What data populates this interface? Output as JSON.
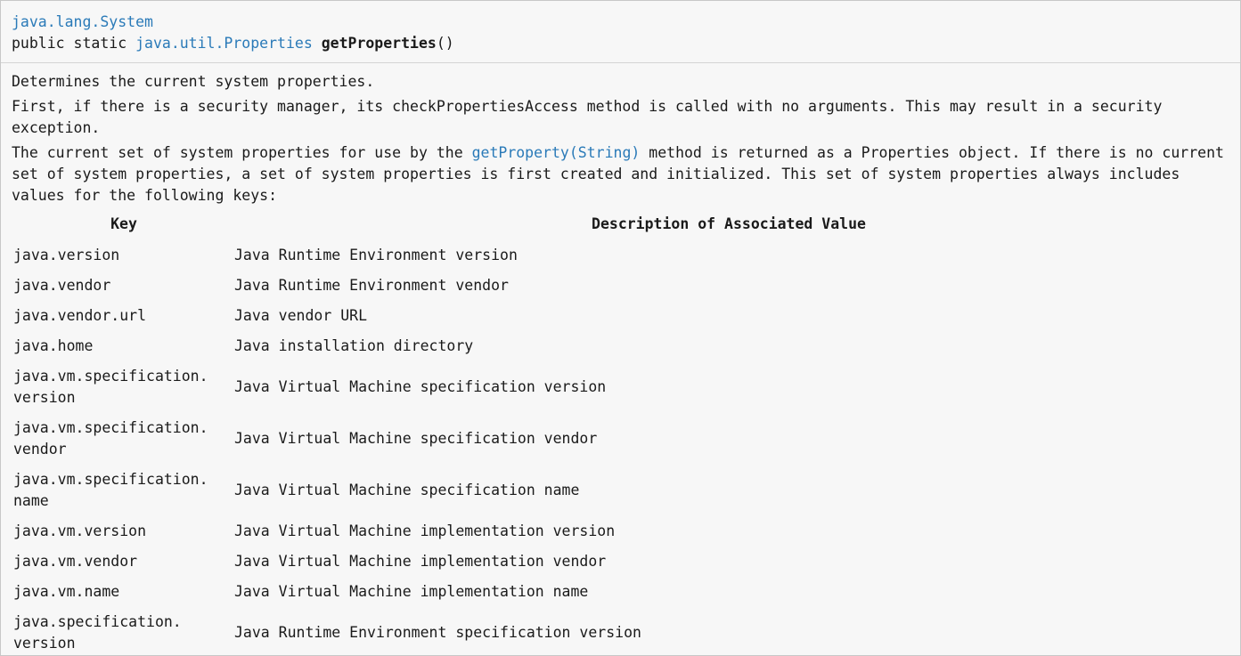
{
  "signature": {
    "class_name": "java.lang.System",
    "modifiers": "public static",
    "return_type": "java.util.Properties",
    "method_name": "getProperties",
    "params": "()"
  },
  "description": {
    "line1": "Determines the current system properties.",
    "para2": "First, if there is a security manager, its checkPropertiesAccess method is called with no arguments. This may result in a security exception.",
    "para3_before": "The current set of system properties for use by the",
    "para3_link": "getProperty(String)",
    "para3_after": "method is returned as a Properties object. If there is no current set of system properties, a set of system properties is first created and initialized. This set of system properties always includes values for the following keys:"
  },
  "table": {
    "headers": [
      "Key",
      "Description of Associated Value"
    ],
    "rows": [
      {
        "key": "java.version",
        "value": "Java Runtime Environment version"
      },
      {
        "key": "java.vendor",
        "value": "Java Runtime Environment vendor"
      },
      {
        "key": "java.vendor.url",
        "value": "Java vendor URL"
      },
      {
        "key": "java.home",
        "value": "Java installation directory"
      },
      {
        "key": "java.vm.specification.\nversion",
        "value": "Java Virtual Machine specification version"
      },
      {
        "key": "java.vm.specification.\nvendor",
        "value": "Java Virtual Machine specification vendor"
      },
      {
        "key": "java.vm.specification.\nname",
        "value": "Java Virtual Machine specification name"
      },
      {
        "key": "java.vm.version",
        "value": "Java Virtual Machine implementation version"
      },
      {
        "key": "java.vm.vendor",
        "value": "Java Virtual Machine implementation vendor"
      },
      {
        "key": "java.vm.name",
        "value": "Java Virtual Machine implementation name"
      },
      {
        "key": "java.specification.\nversion",
        "value": "Java Runtime Environment specification version"
      }
    ]
  },
  "colors": {
    "link": "#2a7ab8",
    "background": "#f7f7f7",
    "text": "#1a1a1a"
  }
}
